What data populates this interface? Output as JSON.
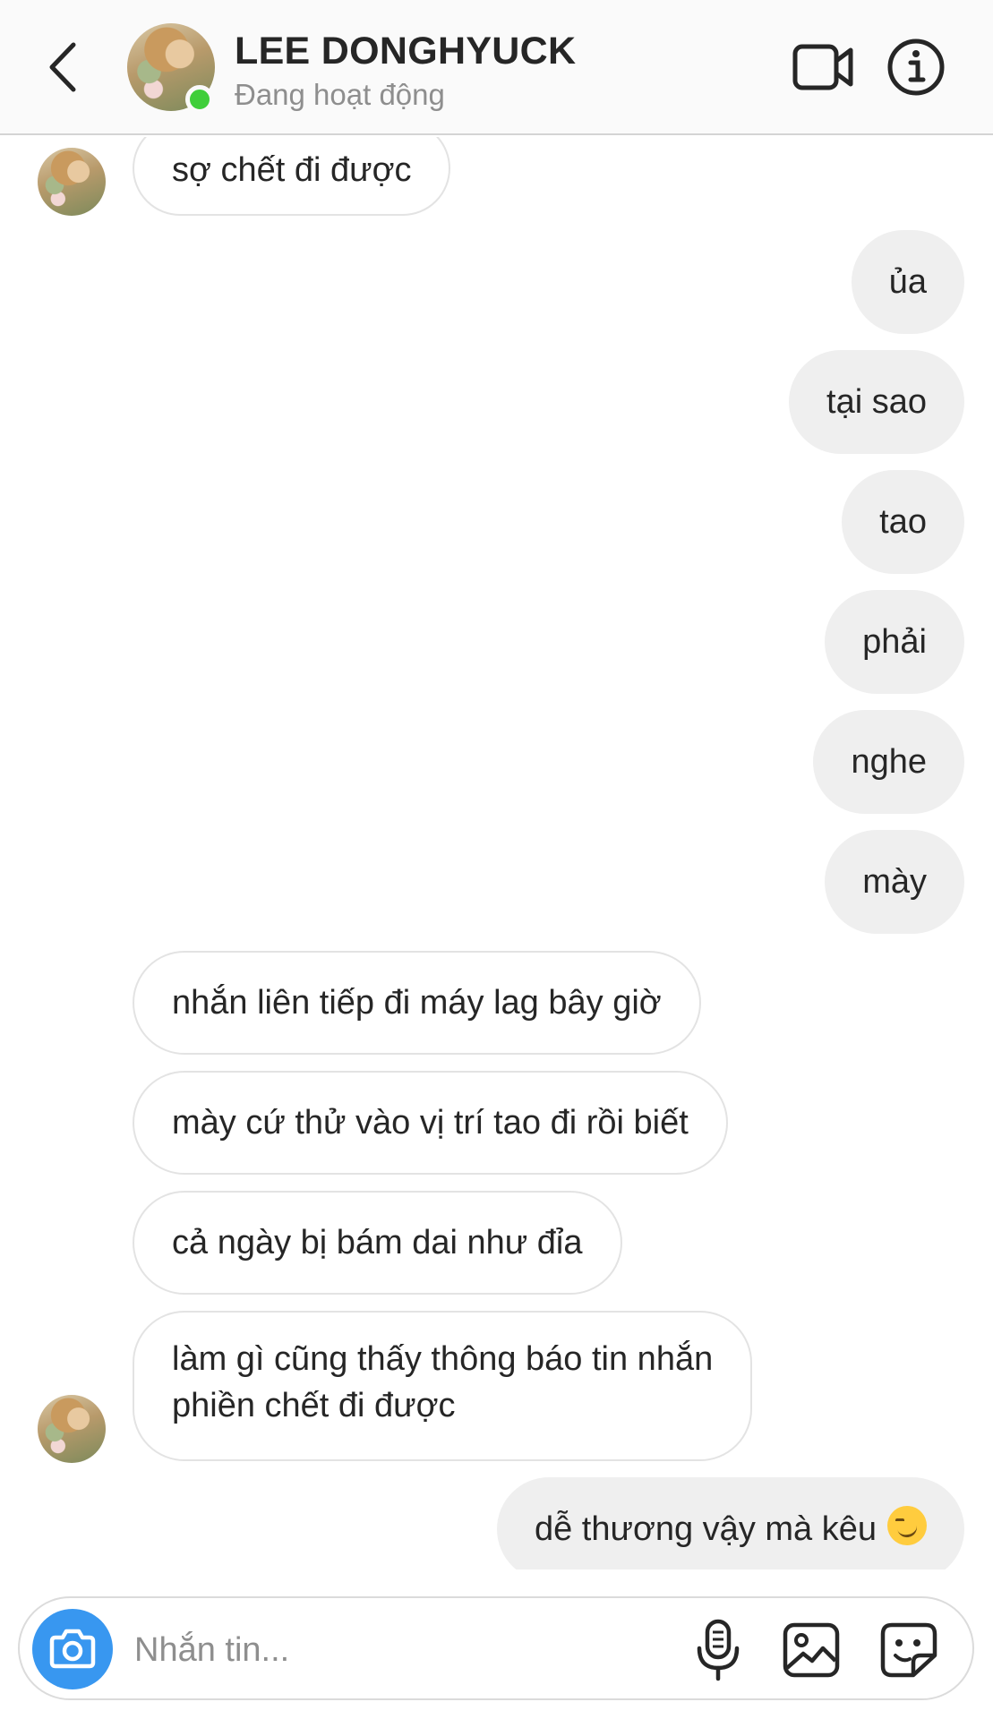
{
  "header": {
    "contact_name": "LEE DONGHYUCK",
    "status": "Đang hoạt động",
    "online": true,
    "icons": [
      "back-icon",
      "video-call-icon",
      "info-icon"
    ]
  },
  "messages": [
    {
      "side": "in",
      "text": "sợ chết đi được"
    },
    {
      "side": "out",
      "text": "ủa"
    },
    {
      "side": "out",
      "text": "tại sao"
    },
    {
      "side": "out",
      "text": "tao"
    },
    {
      "side": "out",
      "text": "phải"
    },
    {
      "side": "out",
      "text": "nghe"
    },
    {
      "side": "out",
      "text": "mày"
    },
    {
      "side": "in",
      "text": "nhắn liên tiếp đi máy lag bây giờ"
    },
    {
      "side": "in",
      "text": "mày cứ thử vào vị trí tao đi rồi biết"
    },
    {
      "side": "in",
      "text": "cả ngày bị bám dai như đỉa"
    },
    {
      "side": "in",
      "line1": "làm gì cũng thấy thông báo tin nhắn",
      "line2": "phiền chết đi được"
    },
    {
      "side": "out",
      "text": "dễ thương vậy mà kêu",
      "emoji": "smirking-face"
    }
  ],
  "composer": {
    "placeholder": "Nhắn tin...",
    "icons": [
      "camera-icon",
      "microphone-icon",
      "gallery-icon",
      "sticker-icon"
    ]
  },
  "colors": {
    "accent": "#3897f0",
    "online": "#3fce3a",
    "outgoing_bubble": "#efefef",
    "incoming_border": "#e3e3e3"
  }
}
